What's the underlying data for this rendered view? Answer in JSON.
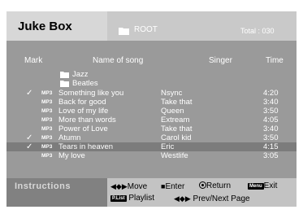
{
  "header": {
    "title": "Juke Box",
    "folder_icon": "folder-icon",
    "current_folder": "ROOT",
    "total": "Total : 030"
  },
  "columns": {
    "mark": "Mark",
    "name": "Name of song",
    "singer": "Singer",
    "time": "Time"
  },
  "folders": [
    {
      "name": "Jazz",
      "icon": "folder-icon"
    },
    {
      "name": "Beatles",
      "icon": "folder-icon"
    }
  ],
  "songs": [
    {
      "checked": true,
      "badge": "MP3",
      "title": "Something like you",
      "singer": "Nsync",
      "time": "4:20",
      "selected": false
    },
    {
      "checked": false,
      "badge": "MP3",
      "title": "Back for good",
      "singer": "Take that",
      "time": "3:40",
      "selected": false
    },
    {
      "checked": false,
      "badge": "MP3",
      "title": "Love of my life",
      "singer": "Queen",
      "time": "3:50",
      "selected": false
    },
    {
      "checked": false,
      "badge": "MP3",
      "title": "More than words",
      "singer": "Extream",
      "time": "4:05",
      "selected": false
    },
    {
      "checked": false,
      "badge": "MP3",
      "title": "Power of Love",
      "singer": "Take that",
      "time": "3:40",
      "selected": false
    },
    {
      "checked": true,
      "badge": "MP3",
      "title": "Atumn",
      "singer": "Carol kid",
      "time": "3:50",
      "selected": false
    },
    {
      "checked": true,
      "badge": "MP3",
      "title": "Tears in heaven",
      "singer": "Eric",
      "time": "4:15",
      "selected": true
    },
    {
      "checked": false,
      "badge": "MP3",
      "title": "My love",
      "singer": "Westlife",
      "time": "3:05",
      "selected": false
    }
  ],
  "check_mark": "✓",
  "instructions": {
    "label": "Instructions",
    "move": "Move",
    "enter": "Enter",
    "return": "Return",
    "menu_tag": "Menu",
    "exit": "Exit",
    "playlist_tag": "P.List",
    "playlist": "Playlist",
    "prevnext": "Prev/Next Page",
    "move_icon": "◆",
    "enter_icon": "■",
    "prevnext_icon": "◀◆▶",
    "move_glyph": "◀◆▶"
  }
}
